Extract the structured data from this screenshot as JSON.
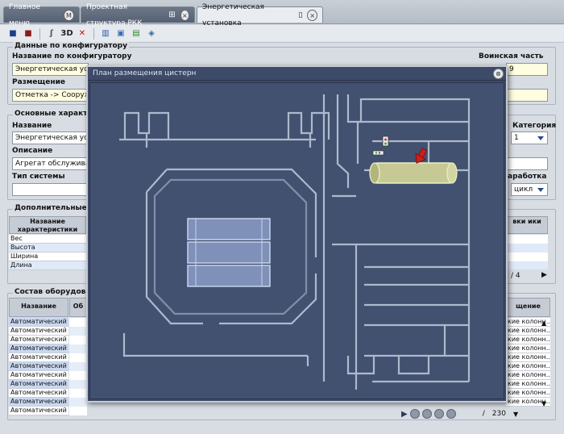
{
  "tabs": [
    {
      "label": "Главное меню",
      "icon": "M"
    },
    {
      "label": "Проектная структура РКК",
      "icon": "tree"
    },
    {
      "label": "Энергетическая установка",
      "icon": "doc"
    }
  ],
  "toolbar": [
    "save-icon",
    "save-as-icon",
    "formula-icon",
    "3D",
    "delete-icon",
    "books-icon",
    "window-icon",
    "export-icon",
    "stack-icon"
  ],
  "config_section": {
    "legend": "Данные по конфигуратору",
    "name_label": "Название по конфигуратору",
    "name_value": "Энергетическая устано",
    "placement_label": "Размещение",
    "placement_value": "Отметка     -> Сооружен",
    "unit_label": "Воинская часть",
    "unit_value": "9"
  },
  "main_section": {
    "legend": "Основные характеристи",
    "name_label": "Название",
    "name_value": "Энергетическая устано",
    "desc_label": "Описание",
    "desc_value": "Агрегат обслуживания. Д",
    "sys_label": "Тип системы",
    "sys_value": "",
    "category_label": "Категория",
    "category_value": "1",
    "work_label": "аработка",
    "work_value": "цикл"
  },
  "extra_section": {
    "legend": "Дополнительные харак",
    "col1": "Название характеристики",
    "col2": "вки ики",
    "rows": [
      "Вес",
      "Высота",
      "Ширина",
      "Длина"
    ],
    "pager": "/     4"
  },
  "equip_section": {
    "legend": "Состав оборудования",
    "col_name": "Название",
    "col_ob": "Об",
    "col_right": "щение",
    "rows": [
      "Автоматический ...",
      "Автоматический ...",
      "Автоматический ...",
      "Автоматический ...",
      "Автоматический ...",
      "Автоматический ...",
      "Автоматический ...",
      "Автоматический ...",
      "Автоматический ...",
      "Автоматический ...",
      "Автоматический ..."
    ],
    "right_rows": [
      "кие колонн...",
      "кие колонн...",
      "кие колонн...",
      "кие колонн...",
      "кие колонн...",
      "кие колонн...",
      "кие колонн...",
      "кие колонн...",
      "кие колонн...",
      "кие колонн..."
    ],
    "page_sep": "/",
    "page_total": "230"
  },
  "modal": {
    "title": "План размещения цистерн",
    "close": "⊗"
  }
}
